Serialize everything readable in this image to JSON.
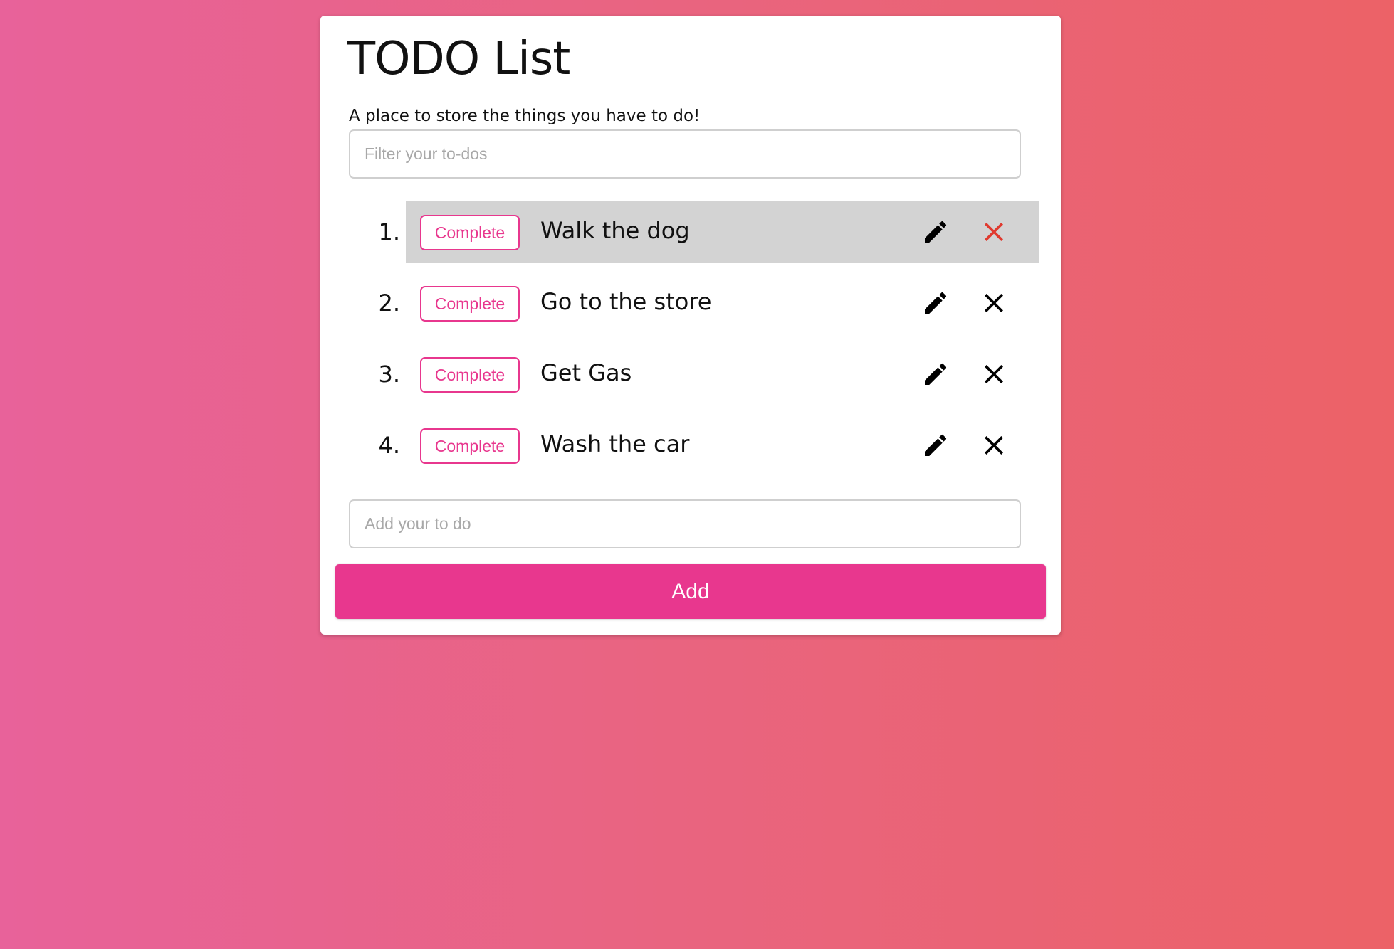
{
  "app": {
    "title": "TODO List",
    "subtitle": "A place to store the things you have to do!"
  },
  "filter": {
    "placeholder": "Filter your to-dos",
    "value": ""
  },
  "todos": [
    {
      "number": "1.",
      "complete_label": "Complete",
      "text": "Walk the dog",
      "highlighted": true
    },
    {
      "number": "2.",
      "complete_label": "Complete",
      "text": "Go to the store",
      "highlighted": false
    },
    {
      "number": "3.",
      "complete_label": "Complete",
      "text": "Get Gas",
      "highlighted": false
    },
    {
      "number": "4.",
      "complete_label": "Complete",
      "text": "Wash the car",
      "highlighted": false
    }
  ],
  "add_input": {
    "placeholder": "Add your to do",
    "value": ""
  },
  "add_button": {
    "label": "Add"
  },
  "colors": {
    "accent": "#e8378e",
    "delete_hover": "#e03a2f",
    "highlight_row": "#d3d3d3"
  },
  "icons": {
    "edit": "pencil-icon",
    "delete": "close-icon"
  }
}
